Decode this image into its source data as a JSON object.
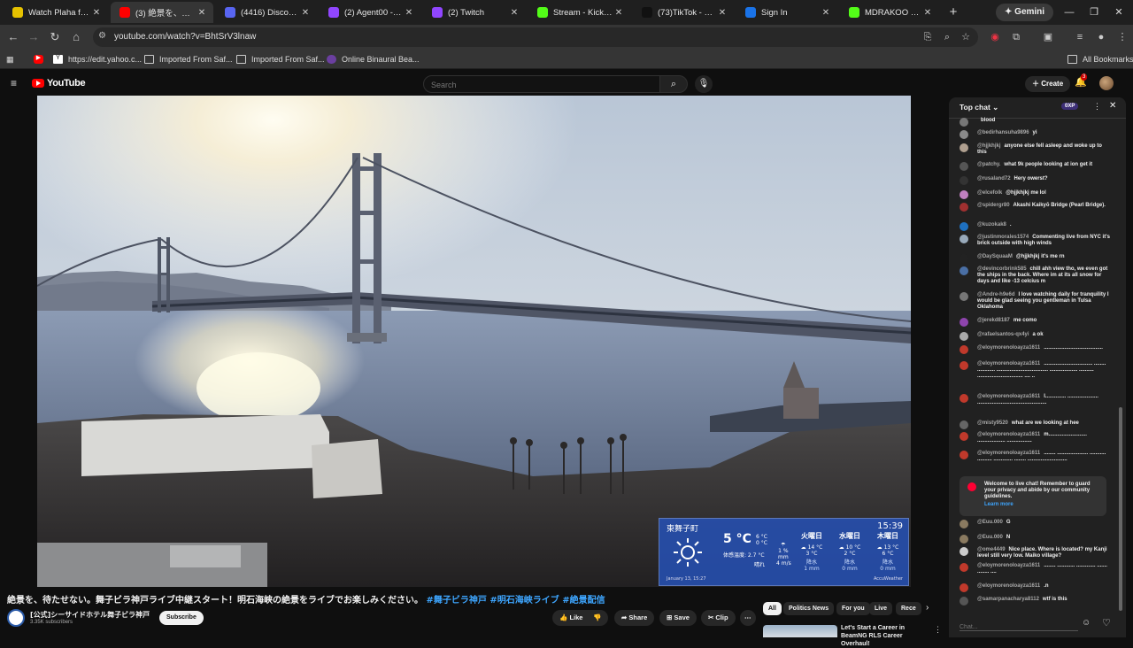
{
  "browser": {
    "tabs": [
      {
        "label": "Watch Plaha full HD",
        "favicon_color": "#e6c200",
        "active": false
      },
      {
        "label": "(3) 絶景を、待たせない",
        "favicon_color": "#ff0000",
        "active": true
      },
      {
        "label": "(4416) Discord | #",
        "favicon_color": "#5865f2",
        "active": false
      },
      {
        "label": "(2) Agent00 - Twitch",
        "favicon_color": "#9146ff",
        "active": false
      },
      {
        "label": "(2) Twitch",
        "favicon_color": "#9146ff",
        "active": false
      },
      {
        "label": "Stream - Kick Dashb",
        "favicon_color": "#53fc18",
        "active": false
      },
      {
        "label": "(73)TikTok - Make Y",
        "favicon_color": "#111111",
        "active": false
      },
      {
        "label": "Sign In",
        "favicon_color": "#1a73e8",
        "active": false
      },
      {
        "label": "MDRAKOO Stream",
        "favicon_color": "#53fc18",
        "active": false
      }
    ],
    "tab_close": "✕",
    "new_tab": "+",
    "gemini_label": "Gemini",
    "window_controls": {
      "minimize": "—",
      "maximize": "❐",
      "close": "✕"
    },
    "url": "youtube.com/watch?v=BhtSrV3lnaw",
    "bookmarks": [
      {
        "label": "",
        "icon": "youtube-icon"
      },
      {
        "label": "https://edit.yahoo.c...",
        "icon": "yahoo-icon"
      },
      {
        "label": "Imported From Saf...",
        "icon": "folder-icon"
      },
      {
        "label": "Imported From Saf...",
        "icon": "folder-icon"
      },
      {
        "label": "Online Binaural Bea...",
        "icon": "page-icon"
      }
    ],
    "all_bookmarks": "All Bookmarks"
  },
  "youtube": {
    "logo_text": "YouTube",
    "search_placeholder": "Search",
    "create_label": "Create",
    "notification_count": "3"
  },
  "weather": {
    "location": "東舞子町",
    "time": "15:39",
    "temp": "5 °C",
    "hi": "6 °C",
    "lo": "0 °C",
    "feels": "体感温度: 2.7 °C",
    "condition": "晴れ",
    "rain": "1 %",
    "rain_unit": "mm",
    "wind": "4 m/s",
    "days": [
      {
        "name": "火曜日",
        "hi": "14 °C",
        "lo": "3 °C",
        "rain_label": "降水",
        "rain": "1 mm"
      },
      {
        "name": "水曜日",
        "hi": "10 °C",
        "lo": "2 °C",
        "rain_label": "降水",
        "rain": "0 mm"
      },
      {
        "name": "木曜日",
        "hi": "13 °C",
        "lo": "6 °C",
        "rain_label": "降水",
        "rain": "0 mm"
      }
    ],
    "date": "January 13, 15:27",
    "brand": "AccuWeather"
  },
  "video": {
    "title": "絶景を、待たせない。舞子ビラ神戸ライブ中継スタート！明石海峡の絶景をライブでお楽しみください。",
    "hashtags": "#舞子ビラ神戸 #明石海峡ライブ #絶景配信",
    "channel": "[公式]シーサイドホテル舞子ビラ神戸",
    "subscribers": "3.35K subscribers",
    "subscribe_label": "Subscribe",
    "actions": {
      "like": "Like",
      "share": "Share",
      "save": "Save",
      "clip": "Clip"
    }
  },
  "recommendations": {
    "chips": [
      "All",
      "Politics News",
      "For you",
      "Live",
      "Rece"
    ],
    "first_title": "Let's Start a Career in BeamNG RLS Career Overhaul!"
  },
  "chat": {
    "title": "Top chat",
    "points": "0XP",
    "messages": [
      {
        "author": "",
        "text": "blood",
        "color": "#777"
      },
      {
        "author": "@bedirhansuha9896",
        "text": "yi",
        "color": "#8a8a8a"
      },
      {
        "author": "@hjjkhjkj",
        "text": "anyone else fell asleep and woke up to this",
        "color": "#b0a090"
      },
      {
        "author": "@patchy.",
        "text": "what 9k people looking at ion get it",
        "color": "#555"
      },
      {
        "author": "@rusaland72",
        "text": "Hery owerst?",
        "color": "#333"
      },
      {
        "author": "@elcefolk",
        "text": "@hjjkhjkj me lol",
        "color": "#c080c0"
      },
      {
        "author": "@spidergr80",
        "text": "Akashi Kaikyō Bridge (Pearl Bridge).",
        "color": "#a03030"
      },
      {
        "author": "@kuzokak8",
        "text": ".",
        "color": "#1e70c0"
      },
      {
        "author": "@justinmorales1574",
        "text": "Commenting live from NYC it's brick outside with high winds",
        "color": "#9ab"
      },
      {
        "author": "@DaySquaaM",
        "text": "@hjjkhjkj it's me rn",
        "color": "#222"
      },
      {
        "author": "@devincorbrink585",
        "text": "chill ahh view tho, we even got the ships in the back. Where im at its all snow for days and like -13 celcius m",
        "color": "#4a6fa5"
      },
      {
        "author": "@Andre-h9e6d",
        "text": "I love watching daily for tranquility I would be glad seeing you gentleman in Tulsa Oklahoma",
        "color": "#777"
      },
      {
        "author": "@jerekd8187",
        "text": "me como",
        "color": "#8e44ad"
      },
      {
        "author": "@rafaelsantos-qx4yi",
        "text": "a ok",
        "color": "#aaa"
      },
      {
        "author": "@eloymorenoloayza1611",
        "text": "........................................",
        "color": "#c0392b"
      },
      {
        "author": "@eloymorenoloayza1611",
        "text": "................................. ........ ............ ................................... ................... .......... ............................... .... ..",
        "color": "#c0392b"
      },
      {
        "author": "@eloymorenoloayza1611",
        "text": "I.............. ..................... ...............................................",
        "color": "#c0392b"
      },
      {
        "author": "@misty9520",
        "text": "what are we looking at hee",
        "color": "#666"
      },
      {
        "author": "@eloymorenoloayza1611",
        "text": "m.......................... ................... .................",
        "color": "#c0392b"
      },
      {
        "author": "@eloymorenoloayza1611",
        "text": "........ ..................... ........... .......... ............. ........ ...........................",
        "color": "#c0392b"
      },
      {
        "author": "@Euu.000",
        "text": "G",
        "color": "#8a7a60"
      },
      {
        "author": "@Euu.000",
        "text": "N",
        "color": "#8a7a60"
      },
      {
        "author": "@ome4449",
        "text": "Nice place. Where is located? my Kanji level still very low. Maiko village?",
        "color": "#ccc"
      },
      {
        "author": "@eloymorenoloayza1611",
        "text": "........ ............ ............. ....... ........ ....",
        "color": "#c0392b"
      },
      {
        "author": "@eloymorenoloayza1611",
        "text": ".n",
        "color": "#c0392b"
      },
      {
        "author": "@samarpanacharya8112",
        "text": "wtf is this",
        "color": "#555"
      }
    ],
    "welcome_text": "Welcome to live chat! Remember to guard your privacy and abide by our community guidelines.",
    "learn_more": "Learn more",
    "input_placeholder": "Chat..."
  }
}
